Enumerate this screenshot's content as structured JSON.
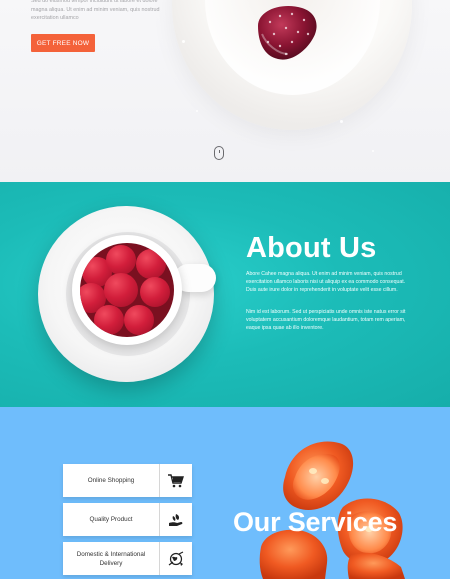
{
  "hero": {
    "text": "Sed do eiusmod tempor incididunt ut labore et dolore magna aliqua. Ut enim ad minim veniam, quis nostrud exercitation ullamco",
    "cta_label": "GET FREE NOW"
  },
  "about": {
    "title": "About Us",
    "paragraph_1": "Abore Cahee magna aliqua. Ut enim ad minim veniam, quis nostrud exercitation ullamco laboris nisi ut aliquip ex ea commodo consequat. Duis aute irure dolor in reprehenderit in voluptate velit esse cillum.",
    "paragraph_2": "Nim id est laborum. Sed ut perspiciatis unde omnis iste natus error sit voluptatem accusantium doloremque laudantium, totam rem aperiam, eaque ipsa quae ab illo inventore."
  },
  "services": {
    "title": "Our Services",
    "items": [
      {
        "label": "Online Shopping",
        "icon": "shopping-cart-icon"
      },
      {
        "label": "Quality Product",
        "icon": "leaf-hand-icon"
      },
      {
        "label": "Domestic & International Delivery",
        "icon": "globe-delivery-icon"
      }
    ]
  },
  "colors": {
    "cta": "#f4623a",
    "about_bg": "#1cbcb8",
    "services_bg": "#6fbdfc"
  }
}
